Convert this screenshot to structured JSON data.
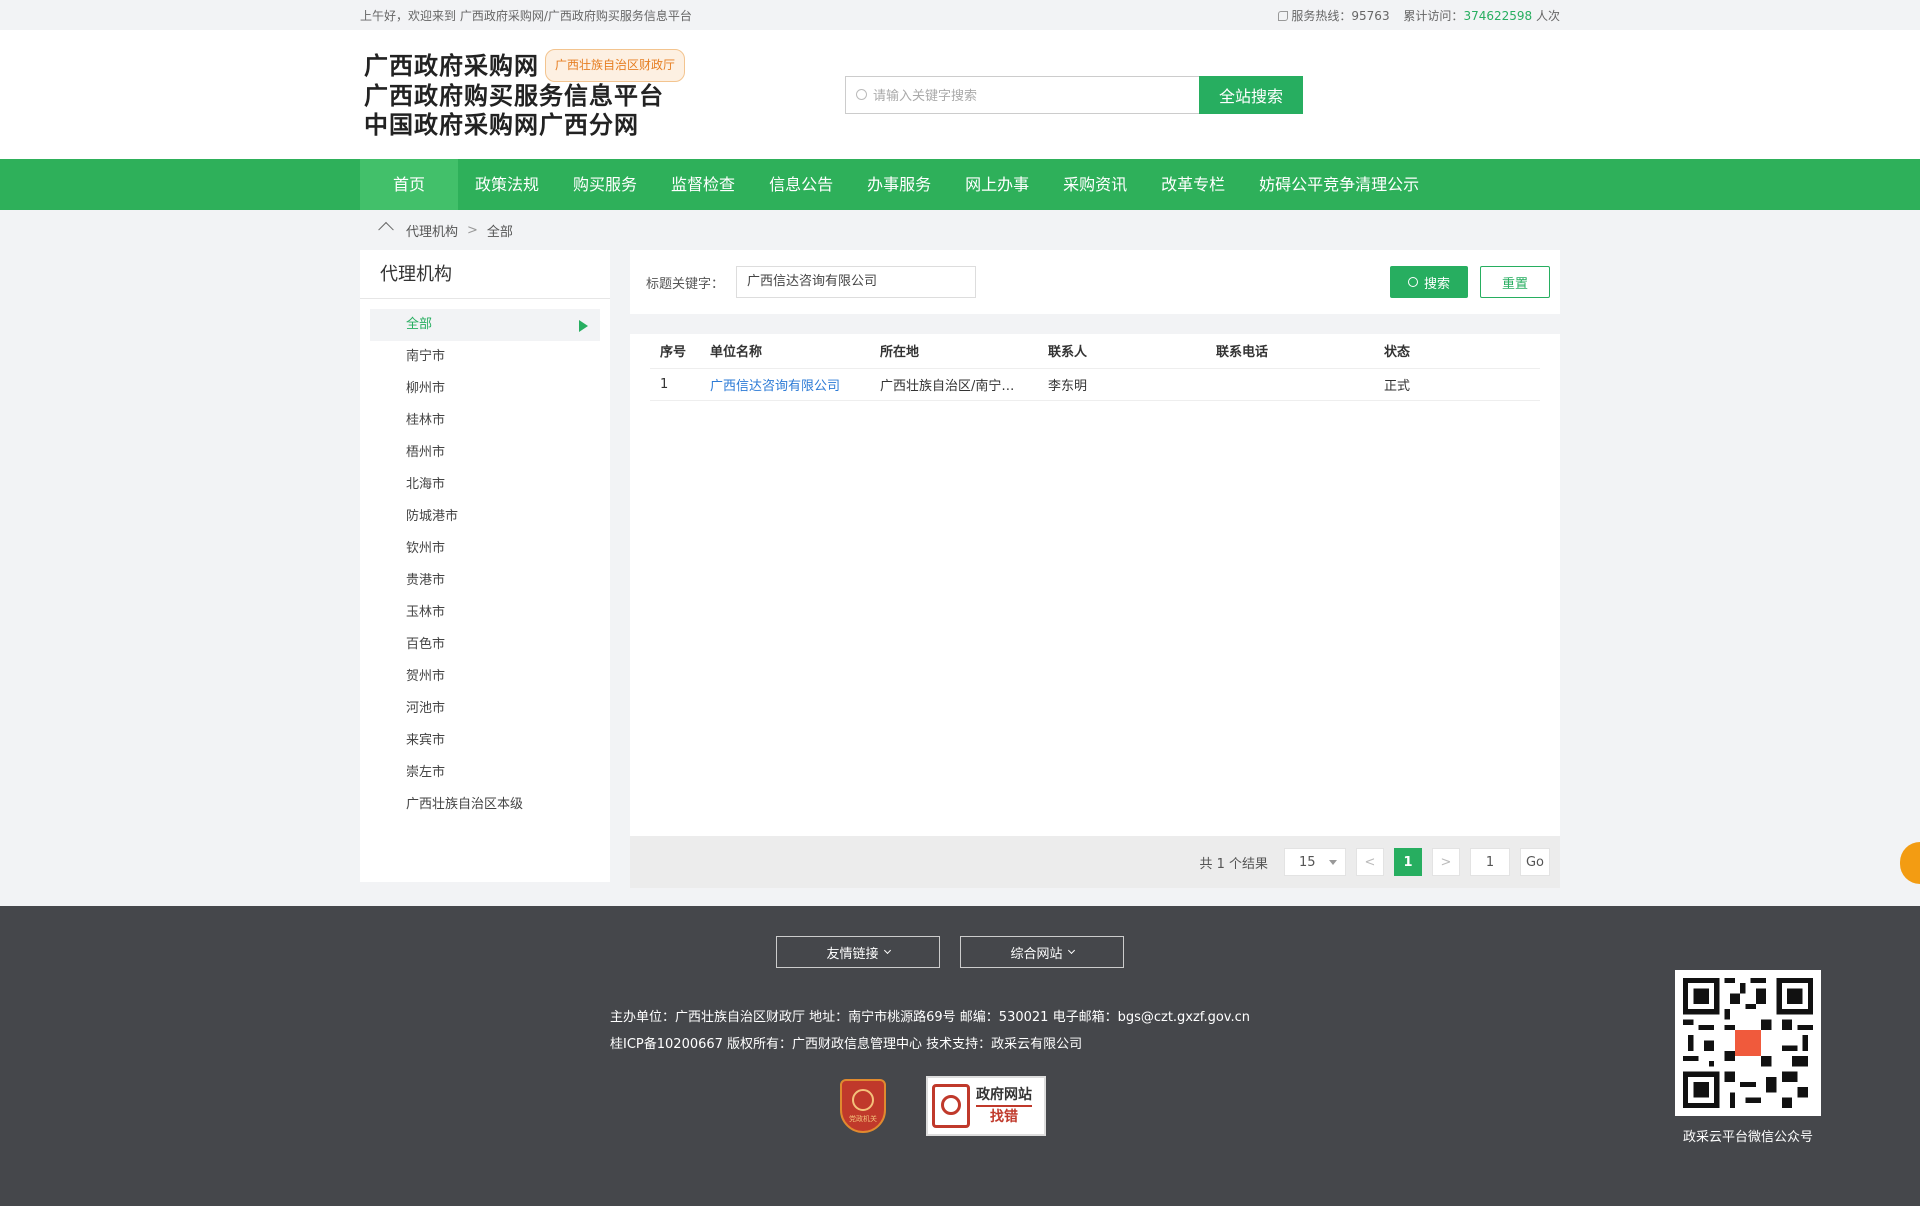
{
  "topbar": {
    "welcome": "上午好，欢迎来到 广西政府采购网/广西政府购买服务信息平台",
    "hotline_label": "服务热线：95763",
    "visits_label": "累计访问：",
    "visits_count": "374622598",
    "visits_unit": "人次"
  },
  "header": {
    "logo_line1": "广西政府采购网",
    "logo_badge": "广西壮族自治区财政厅",
    "logo_line2": "广西政府购买服务信息平台",
    "logo_line3": "中国政府采购网广西分网",
    "search_placeholder": "请输入关键字搜索",
    "search_button": "全站搜索"
  },
  "nav": {
    "items": [
      "首页",
      "政策法规",
      "购买服务",
      "监督检查",
      "信息公告",
      "办事服务",
      "网上办事",
      "采购资讯",
      "改革专栏",
      "妨碍公平竞争清理公示"
    ]
  },
  "breadcrumb": {
    "level1": "代理机构",
    "level2": "全部"
  },
  "sidebar": {
    "title": "代理机构",
    "items": [
      "全部",
      "南宁市",
      "柳州市",
      "桂林市",
      "梧州市",
      "北海市",
      "防城港市",
      "钦州市",
      "贵港市",
      "玉林市",
      "百色市",
      "贺州市",
      "河池市",
      "来宾市",
      "崇左市",
      "广西壮族自治区本级"
    ]
  },
  "filter": {
    "label": "标题关键字：",
    "value": "广西信达咨询有限公司",
    "search_button": "搜索",
    "reset_button": "重置"
  },
  "table": {
    "headers": [
      "序号",
      "单位名称",
      "所在地",
      "联系人",
      "联系电话",
      "状态"
    ],
    "rows": [
      {
        "no": "1",
        "name": "广西信达咨询有限公司",
        "location": "广西壮族自治区/南宁…",
        "contact": "李东明",
        "phone": "",
        "status": "正式"
      }
    ]
  },
  "pager": {
    "total": "共 1 个结果",
    "page_size": "15",
    "prev": "<",
    "current": "1",
    "next": ">",
    "jump_value": "1",
    "go": "Go"
  },
  "footer": {
    "links_label": "友情链接",
    "sites_label": "综合网站",
    "info_line1": "主办单位：广西壮族自治区财政厅 地址：南宁市桃源路69号 邮编：530021 电子邮箱：bgs@czt.gxzf.gov.cn",
    "info_line2": "桂ICP备10200667 版权所有：广西财政信息管理中心 技术支持：政采云有限公司",
    "emblem_text": "党政机关",
    "jiucuo_line1": "政府网站",
    "jiucuo_line2": "找错",
    "qr_caption": "政采云平台微信公众号"
  }
}
